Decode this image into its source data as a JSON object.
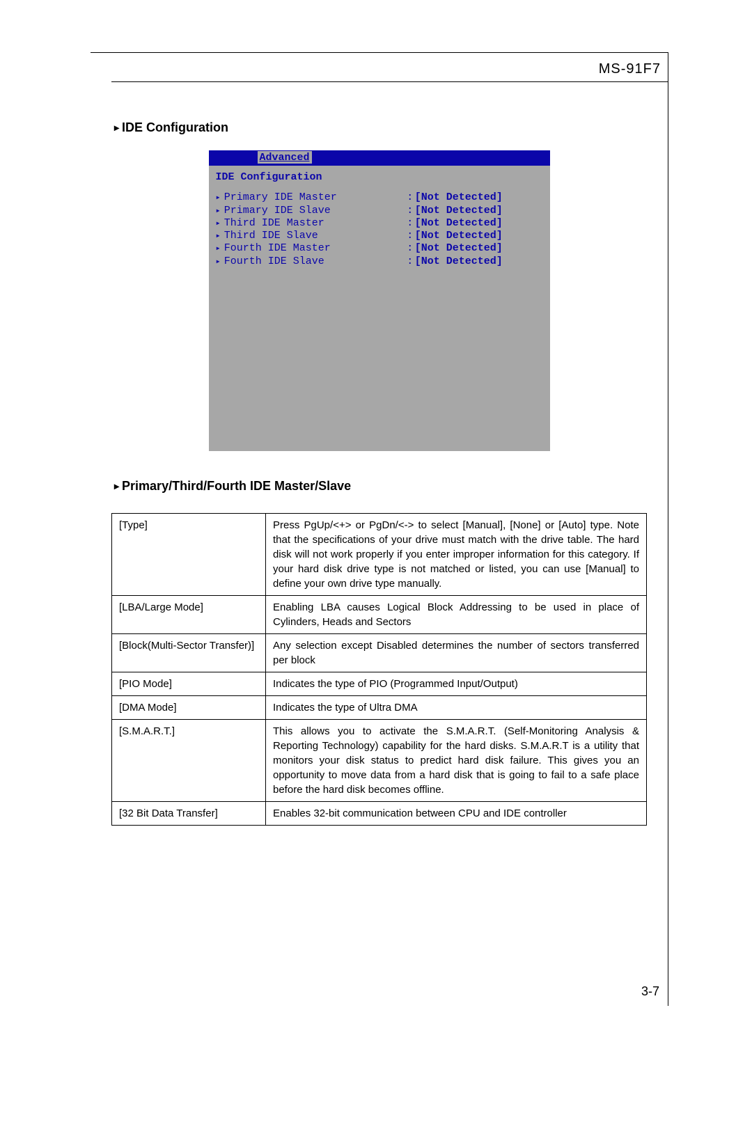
{
  "header": {
    "model": "MS-91F7"
  },
  "section1_title": "IDE Configuration",
  "bios": {
    "tab": "Advanced",
    "heading": "IDE Configuration",
    "colon": ":",
    "items": [
      {
        "label": "Primary IDE Master",
        "value": "[Not Detected]"
      },
      {
        "label": "Primary IDE Slave",
        "value": "[Not Detected]"
      },
      {
        "label": "Third IDE Master",
        "value": "[Not Detected]"
      },
      {
        "label": "Third IDE Slave",
        "value": "[Not Detected]"
      },
      {
        "label": "Fourth IDE Master",
        "value": "[Not Detected]"
      },
      {
        "label": "Fourth IDE Slave",
        "value": "[Not Detected]"
      }
    ]
  },
  "section2_title": "Primary/Third/Fourth IDE Master/Slave",
  "table": {
    "rows": [
      {
        "param": "[Type]",
        "desc": "Press PgUp/<+> or PgDn/<-> to select [Manual], [None] or [Auto] type. Note that the specifications of your drive must match with the drive table. The hard disk will not work properly if you enter improper information for this category. If your hard disk drive type is not matched or listed, you can use [Manual] to define your own drive type manually."
      },
      {
        "param": "[LBA/Large Mode]",
        "desc": "Enabling LBA causes Logical Block Addressing to be used in place of Cylinders, Heads and Sectors"
      },
      {
        "param": "[Block(Multi-Sector Transfer)]",
        "desc": "Any selection except Disabled determines the number of sectors transferred per block"
      },
      {
        "param": "[PIO Mode]",
        "desc": "Indicates the type of PIO (Programmed Input/Output)"
      },
      {
        "param": "[DMA Mode]",
        "desc": "Indicates the type of Ultra DMA"
      },
      {
        "param": "[S.M.A.R.T.]",
        "desc": "This allows you to activate the S.M.A.R.T. (Self-Monitoring Analysis & Reporting Technology) capability for the hard disks. S.M.A.R.T is a utility that monitors your disk status to predict hard disk failure. This gives you an opportunity to move data from a hard disk that is going to fail to a safe place before the hard disk becomes offline."
      },
      {
        "param": "[32 Bit Data Transfer]",
        "desc": "Enables 32-bit communication between CPU and IDE controller"
      }
    ]
  },
  "footer": {
    "page": "3-7"
  },
  "glyphs": {
    "triangle": "▸"
  }
}
